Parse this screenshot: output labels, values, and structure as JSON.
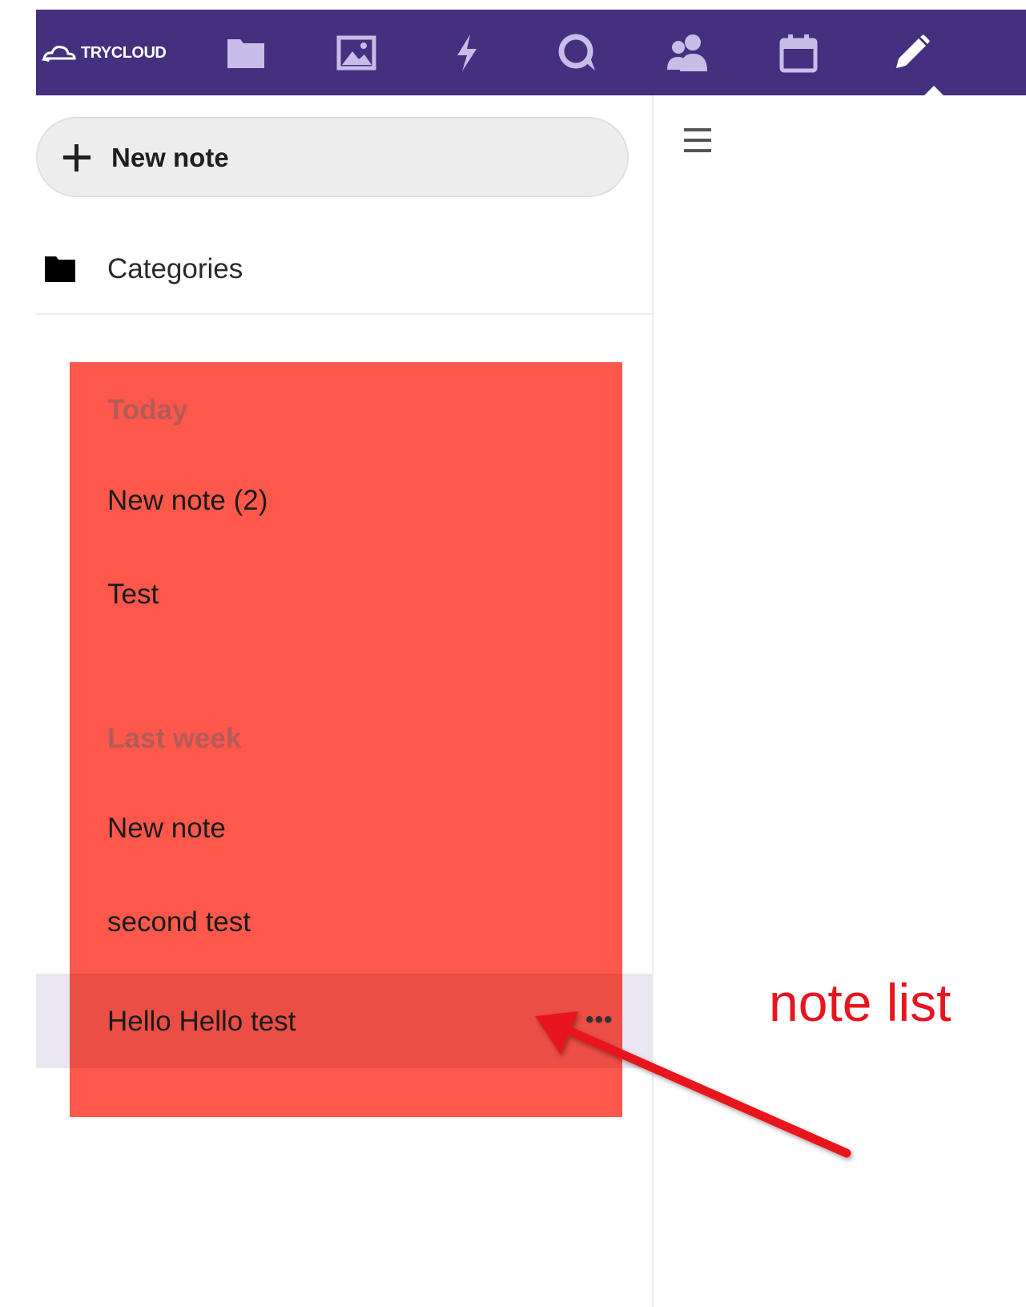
{
  "header": {
    "logo_text": "TRYCLOUD",
    "apps": [
      {
        "icon": "folder-icon",
        "label": "Files"
      },
      {
        "icon": "image-icon",
        "label": "Photos"
      },
      {
        "icon": "activity-icon",
        "label": "Activity"
      },
      {
        "icon": "talk-icon",
        "label": "Talk"
      },
      {
        "icon": "contacts-icon",
        "label": "Contacts"
      },
      {
        "icon": "calendar-icon",
        "label": "Calendar"
      },
      {
        "icon": "pencil-icon",
        "label": "Notes",
        "active": true
      }
    ],
    "background_color": "#45307f"
  },
  "sidebar": {
    "new_note_label": "New note",
    "categories_label": "Categories"
  },
  "note_list": {
    "sections": [
      {
        "heading": "Today",
        "notes": [
          "New note (2)",
          "Test"
        ]
      },
      {
        "heading": "Last week",
        "notes": [
          "New note",
          "second test",
          "Hello Hello test"
        ]
      }
    ],
    "selected_note": "Hello Hello test",
    "more_actions_label": "•••",
    "highlight_color": "#fd584b"
  },
  "annotation": {
    "label": "note list",
    "color": "#e8151f"
  }
}
